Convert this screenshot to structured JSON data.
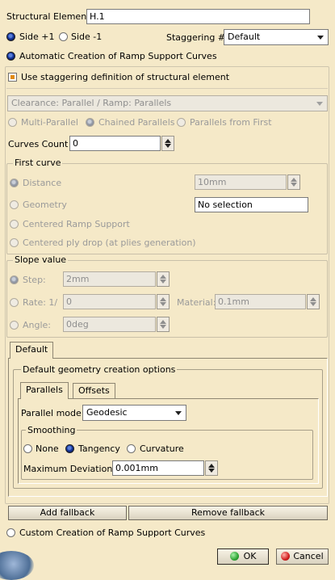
{
  "structural_element": {
    "label": "Structural Element",
    "value": "H.1"
  },
  "side": {
    "plus": "Side +1",
    "minus": "Side -1"
  },
  "staggering": {
    "label": "Staggering #",
    "value": "Default"
  },
  "automatic": {
    "label": "Automatic Creation of Ramp Support Curves"
  },
  "use_staggering": {
    "label": "Use staggering definition of structural element"
  },
  "clearance": {
    "value": "Clearance: Parallel / Ramp: Parallels"
  },
  "parallel_modes": {
    "multi": "Multi-Parallel",
    "chained": "Chained Parallels",
    "first": "Parallels from First"
  },
  "curves_count": {
    "label": "Curves Count",
    "value": "0"
  },
  "first_curve": {
    "title": "First curve",
    "distance": {
      "label": "Distance",
      "value": "10mm"
    },
    "geometry": {
      "label": "Geometry",
      "value": "No selection"
    },
    "centered_ramp": "Centered Ramp Support",
    "centered_ply": "Centered ply drop (at plies generation)"
  },
  "slope": {
    "title": "Slope value",
    "step": {
      "label": "Step:",
      "value": "2mm"
    },
    "rate": {
      "label": "Rate: 1/",
      "value": "0"
    },
    "material": {
      "label": "Material:",
      "value": "0.1mm"
    },
    "angle": {
      "label": "Angle:",
      "value": "0deg"
    }
  },
  "default_tab": "Default",
  "default_geometry": {
    "title": "Default geometry creation options",
    "tabs": {
      "parallels": "Parallels",
      "offsets": "Offsets"
    },
    "parallel_mode": {
      "label": "Parallel mode:",
      "value": "Geodesic"
    },
    "smoothing": {
      "title": "Smoothing",
      "none": "None",
      "tangency": "Tangency",
      "curvature": "Curvature",
      "max_dev_label": "Maximum Deviation:",
      "max_dev_value": "0.001mm"
    }
  },
  "fallback": {
    "add": "Add fallback",
    "remove": "Remove fallback"
  },
  "custom": {
    "label": "Custom Creation of Ramp Support Curves"
  },
  "dialog": {
    "ok": "OK",
    "cancel": "Cancel"
  },
  "colors": {
    "background": "#f5e9c8",
    "ok_icon": "#2fa534",
    "cancel_icon": "#d21e1e",
    "check_fill": "#e28a10"
  }
}
